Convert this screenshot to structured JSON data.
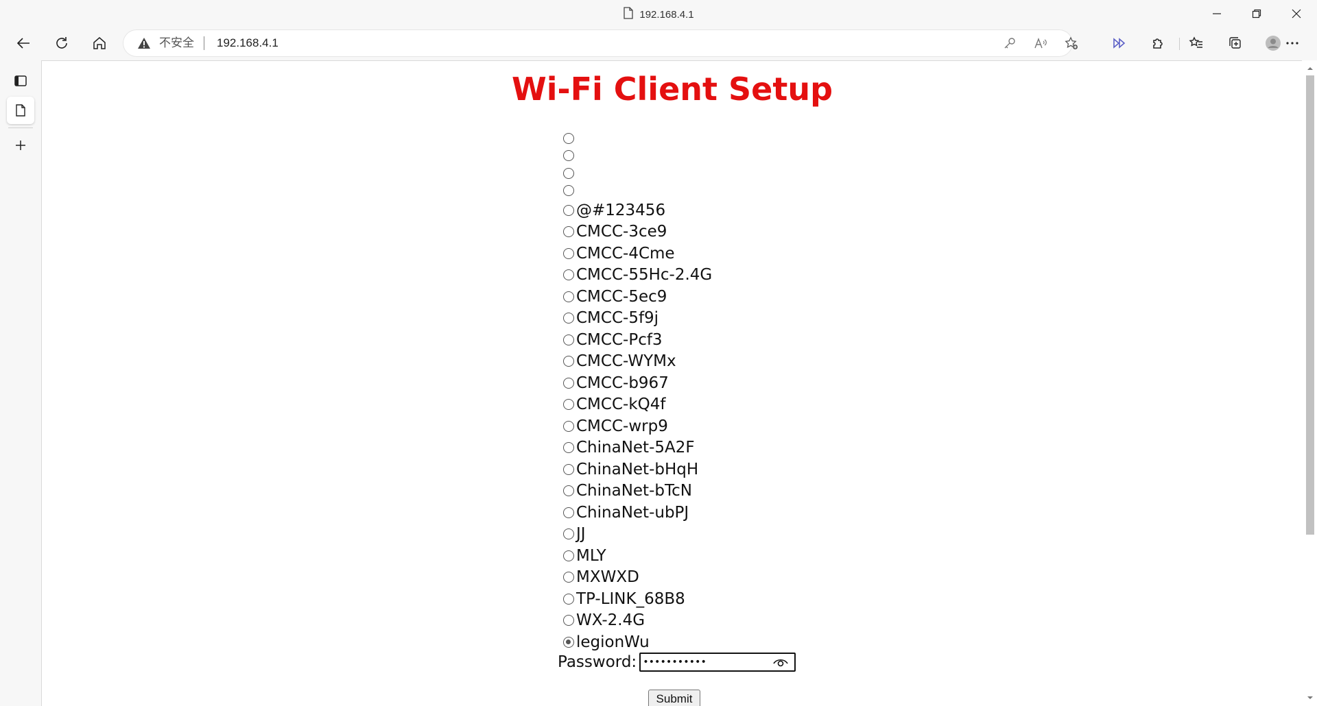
{
  "window": {
    "title": "192.168.4.1"
  },
  "toolbar": {
    "security_label": "不安全",
    "url": "192.168.4.1"
  },
  "page": {
    "heading": "Wi-Fi Client Setup",
    "networks": [
      {
        "ssid": "",
        "selected": false
      },
      {
        "ssid": "",
        "selected": false
      },
      {
        "ssid": "",
        "selected": false
      },
      {
        "ssid": "",
        "selected": false
      },
      {
        "ssid": "@#123456",
        "selected": false
      },
      {
        "ssid": "CMCC-3ce9",
        "selected": false
      },
      {
        "ssid": "CMCC-4Cme",
        "selected": false
      },
      {
        "ssid": "CMCC-55Hc-2.4G",
        "selected": false
      },
      {
        "ssid": "CMCC-5ec9",
        "selected": false
      },
      {
        "ssid": "CMCC-5f9j",
        "selected": false
      },
      {
        "ssid": "CMCC-Pcf3",
        "selected": false
      },
      {
        "ssid": "CMCC-WYMx",
        "selected": false
      },
      {
        "ssid": "CMCC-b967",
        "selected": false
      },
      {
        "ssid": "CMCC-kQ4f",
        "selected": false
      },
      {
        "ssid": "CMCC-wrp9",
        "selected": false
      },
      {
        "ssid": "ChinaNet-5A2F",
        "selected": false
      },
      {
        "ssid": "ChinaNet-bHqH",
        "selected": false
      },
      {
        "ssid": "ChinaNet-bTcN",
        "selected": false
      },
      {
        "ssid": "ChinaNet-ubPJ",
        "selected": false
      },
      {
        "ssid": "JJ",
        "selected": false
      },
      {
        "ssid": "MLY",
        "selected": false
      },
      {
        "ssid": "MXWXD",
        "selected": false
      },
      {
        "ssid": "TP-LINK_68B8",
        "selected": false
      },
      {
        "ssid": "WX-2.4G",
        "selected": false
      },
      {
        "ssid": "legionWu",
        "selected": true
      }
    ],
    "password_label": "Password:",
    "password_value": "•••••••••••",
    "submit_label": "Submit"
  }
}
